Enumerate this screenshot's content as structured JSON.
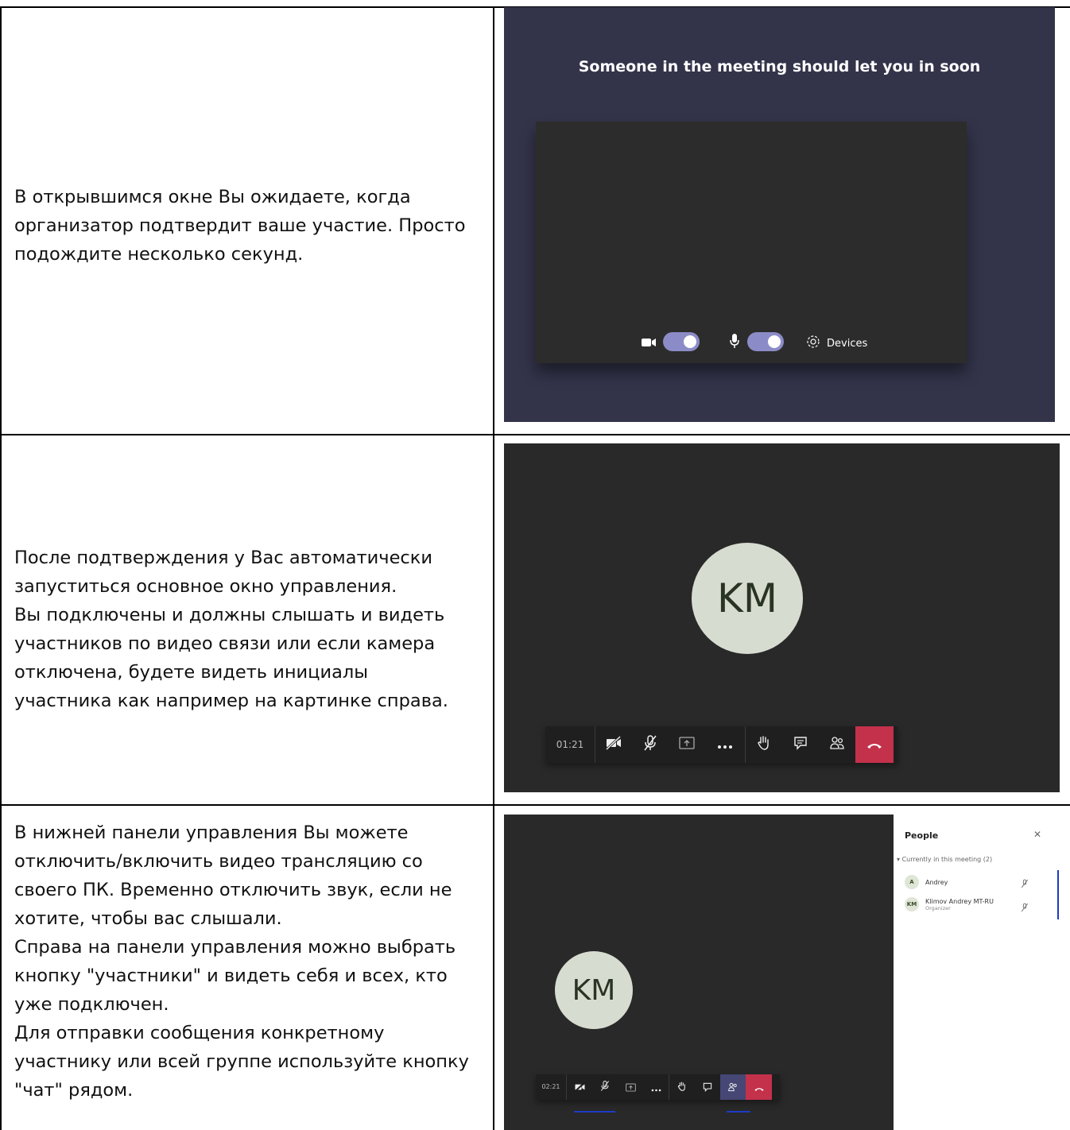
{
  "rows": [
    {
      "text": "В открывшимся окне Вы ожидаете, когда\nорганизатор подтвердит ваше участие. Просто\nподождите несколько секунд."
    },
    {
      "text": "После подтверждения у Вас автоматически\nзапуститься основное окно управления.\nВы подключены и должны слышать и видеть\nучастников по видео связи или если камера\nотключена, будете видеть инициалы\nучастника как например на картинке справа."
    },
    {
      "text": "В нижней панели управления Вы можете\nотключить/включить видео трансляцию со\nсвоего ПК. Временно отключить звук, если не\nхотите, чтобы вас слышали.\nСправа на панели управления можно выбрать\nкнопку \"участники\" и видеть себя и всех, кто\nуже подключен.\nДля отправки сообщения конкретному\nучастнику или всей группе используйте кнопку\n\"чат\" рядом."
    }
  ],
  "lobby": {
    "heading": "Someone in the meeting should let you in soon",
    "devices_label": "Devices",
    "camera_on": true,
    "mic_on": true
  },
  "call": {
    "initials": "KM",
    "timer": "01:21"
  },
  "panel_call": {
    "initials": "KM",
    "timer": "02:21",
    "people": {
      "title": "People",
      "section": "Currently in this meeting (2)",
      "participants": [
        {
          "initials": "A",
          "name": "Andrey",
          "role": ""
        },
        {
          "initials": "KM",
          "name": "Klimov Andrey MT-RU",
          "role": "Organizer"
        }
      ]
    }
  },
  "colors": {
    "lobby_bg": "#33344a",
    "call_bg": "#292929",
    "toggle": "#8b8cc7",
    "hangup": "#c4314b",
    "highlight": "#1c3cc8"
  }
}
